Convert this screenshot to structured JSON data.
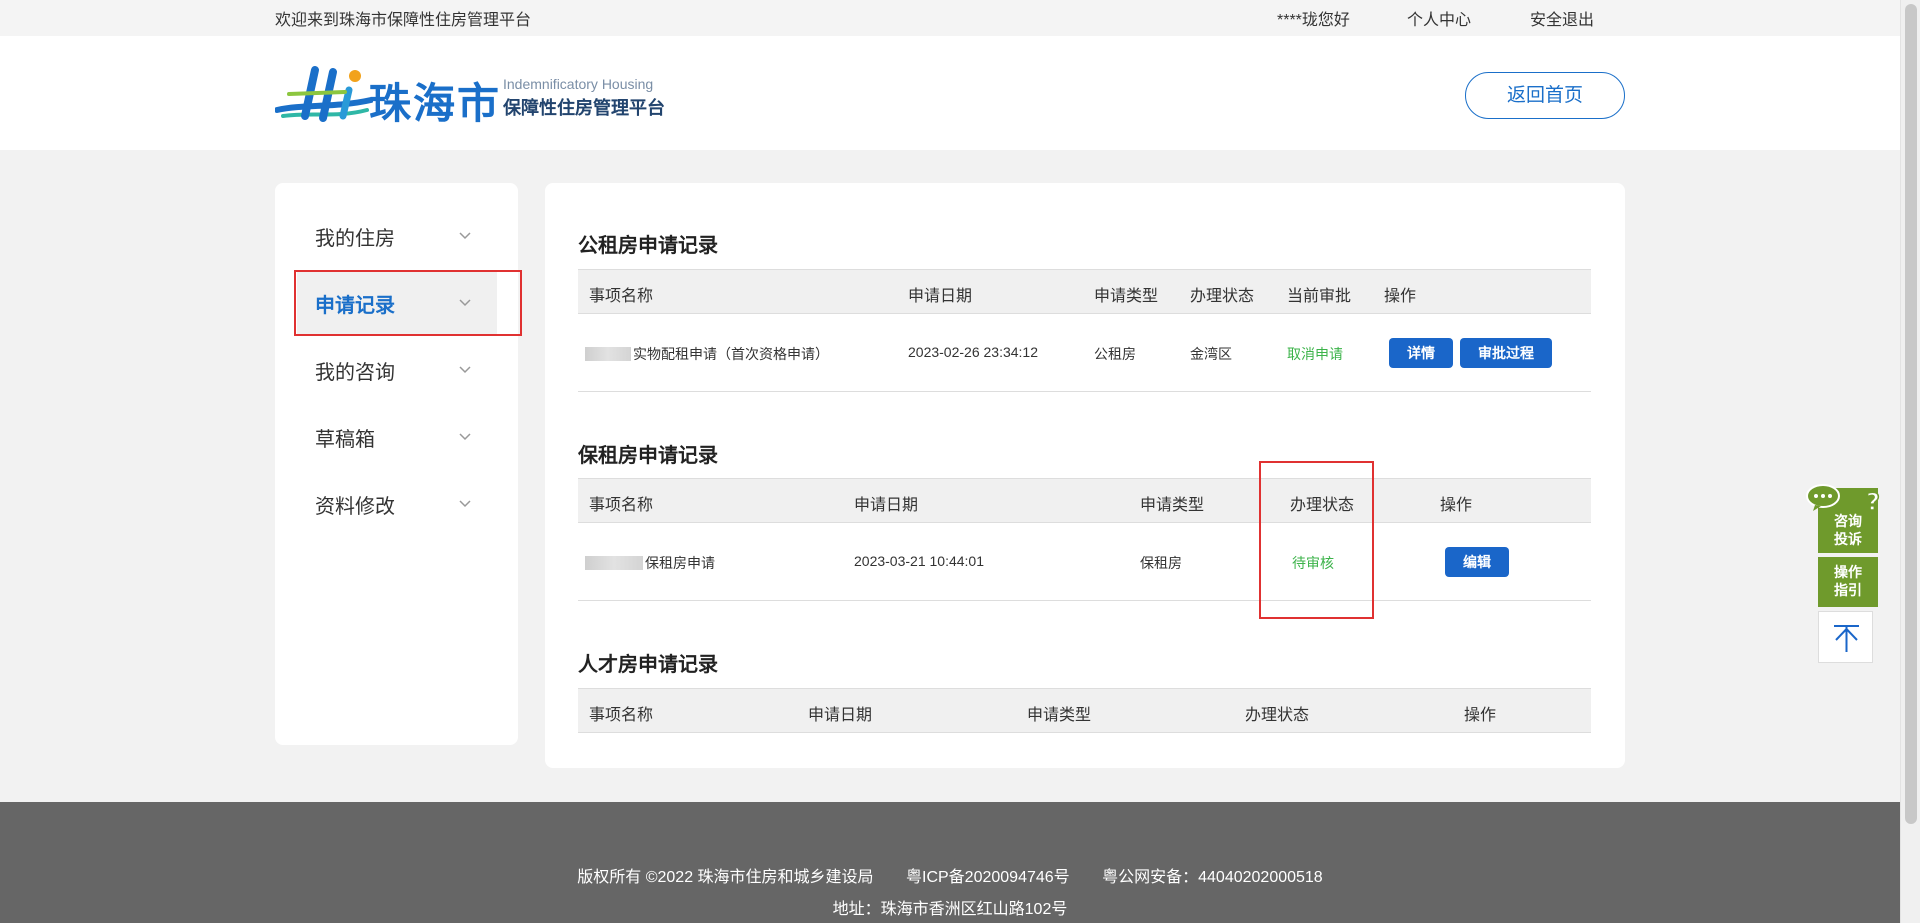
{
  "topbar": {
    "welcome": "欢迎来到珠海市保障性住房管理平台",
    "greeting": "****珑您好",
    "personal_center": "个人中心",
    "logout": "安全退出"
  },
  "header": {
    "logo_city": "珠海市",
    "logo_en": "Indemnificatory Housing",
    "logo_cn": "保障性住房管理平台",
    "home_button": "返回首页"
  },
  "sidebar": {
    "items": [
      {
        "label": "我的住房",
        "active": false
      },
      {
        "label": "申请记录",
        "active": true
      },
      {
        "label": "我的咨询",
        "active": false
      },
      {
        "label": "草稿箱",
        "active": false
      },
      {
        "label": "资料修改",
        "active": false
      }
    ]
  },
  "sections": {
    "public_rental": {
      "title": "公租房申请记录",
      "headers": [
        "事项名称",
        "申请日期",
        "申请类型",
        "办理状态",
        "当前审批",
        "操作"
      ],
      "rows": [
        {
          "name": "实物配租申请（首次资格申请）",
          "date": "2023-02-26 23:34:12",
          "type": "公租房",
          "status": "金湾区",
          "current": "取消申请",
          "actions": [
            "详情",
            "审批过程"
          ]
        }
      ]
    },
    "affordable_rental": {
      "title": "保租房申请记录",
      "headers": [
        "事项名称",
        "申请日期",
        "申请类型",
        "办理状态",
        "操作"
      ],
      "rows": [
        {
          "name": "保租房申请",
          "date": "2023-03-21 10:44:01",
          "type": "保租房",
          "status": "待审核",
          "actions": [
            "编辑"
          ]
        }
      ]
    },
    "talent_housing": {
      "title": "人才房申请记录",
      "headers": [
        "事项名称",
        "申请日期",
        "申请类型",
        "办理状态",
        "操作"
      ],
      "rows": []
    }
  },
  "footer": {
    "copyright": "版权所有 ©2022 珠海市住房和城乡建设局",
    "icp": "粤ICP备2020094746号",
    "police": "粤公网安备：44040202000518",
    "address": "地址：珠海市香洲区红山路102号"
  },
  "float_widget": {
    "consult": "咨询投诉",
    "guide": "操作指引",
    "top_icon": "arrow-up-icon"
  },
  "colors": {
    "brand_blue": "#1a66c9",
    "status_green": "#3cb34a",
    "highlight_red": "#e03131",
    "widget_green": "#6f9a2c",
    "footer_gray": "#666666"
  }
}
